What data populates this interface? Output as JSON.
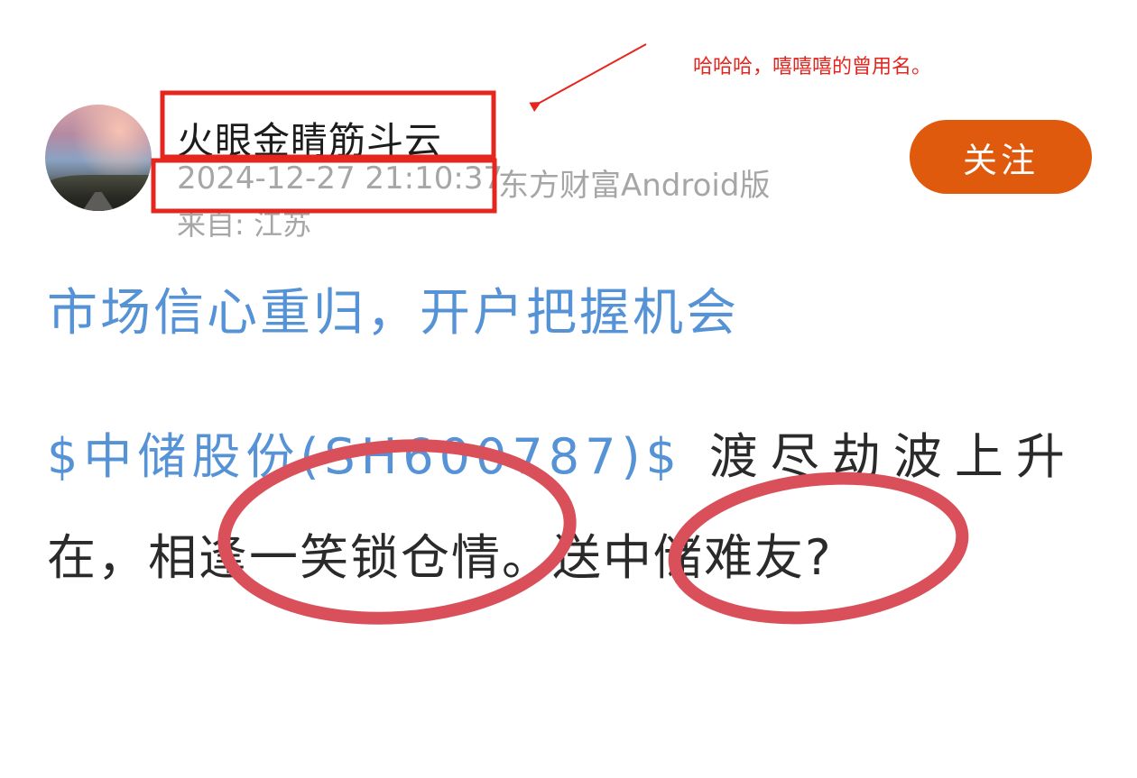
{
  "post": {
    "author": {
      "username": "火眼金睛筋斗云",
      "timestamp": "2024-12-27 21:10:37",
      "app_source": "东方财富Android版",
      "location": "来自: 江苏"
    },
    "follow_label": "关注",
    "title": "市场信心重归，开户把握机会",
    "body": {
      "stock_link": "$中储股份(SH600787)$",
      "text_line1": "渡尽劫波上升",
      "text_line2": "在，相逢一笑锁仓情。送中储难友?"
    }
  },
  "annotation": {
    "note": "哈哈哈，嘻嘻嘻的曾用名。",
    "colors": {
      "red": "#e5261f",
      "circle": "#d9505a"
    }
  },
  "colors": {
    "link_blue": "#5592d6",
    "follow_orange": "#e05a0e",
    "meta_gray": "#a6a6a6"
  }
}
